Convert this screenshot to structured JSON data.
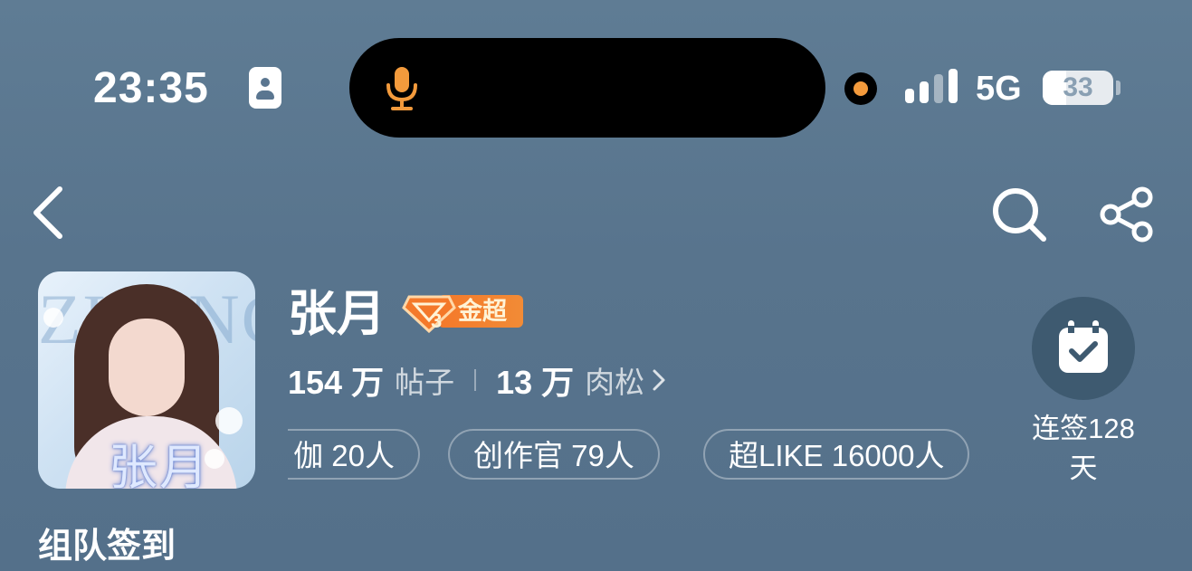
{
  "status_bar": {
    "time": "23:35",
    "network": "5G",
    "battery_level": "33"
  },
  "nav": {
    "back_icon": "chevron-left-icon",
    "search_icon": "search-icon",
    "share_icon": "share-icon"
  },
  "profile": {
    "name": "张月",
    "badge_label": "金超",
    "avatar_text": "张月",
    "avatar_bg_text": "ZHANG"
  },
  "stats": {
    "posts_count": "154 万",
    "posts_label": "帖子",
    "points_count": "13 万",
    "points_label": "肉松"
  },
  "chips": [
    {
      "label": "伽 20人"
    },
    {
      "label": "创作官 79人"
    },
    {
      "label": "超LIKE 16000人"
    }
  ],
  "checkin": {
    "label": "连签128天",
    "icon": "calendar-check-icon"
  },
  "team_checkin": "组队签到",
  "colors": {
    "background": "#58748d",
    "accent": "#f4792a",
    "mic": "#f39a3c"
  }
}
